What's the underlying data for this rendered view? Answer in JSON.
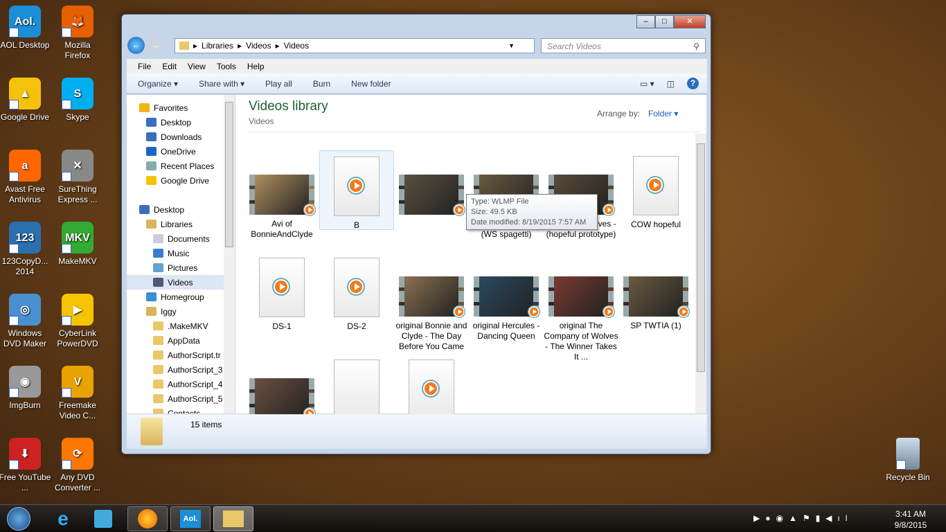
{
  "desktop_icons": [
    {
      "label": "AOL Desktop",
      "color": "#1a8fd8",
      "glyph": "Aol."
    },
    {
      "label": "Mozilla Firefox",
      "color": "#e66000",
      "glyph": "🦊"
    },
    {
      "label": "Google Drive",
      "color": "#f4c20d",
      "glyph": "▲"
    },
    {
      "label": "Skype",
      "color": "#00aff0",
      "glyph": "S"
    },
    {
      "label": "Avast Free Antivirus",
      "color": "#f60",
      "glyph": "a"
    },
    {
      "label": "SureThing Express ...",
      "color": "#888",
      "glyph": "✕"
    },
    {
      "label": "123CopyD... 2014",
      "color": "#2a6fb0",
      "glyph": "123"
    },
    {
      "label": "MakeMKV",
      "color": "#3a3",
      "glyph": "MKV"
    },
    {
      "label": "Windows DVD Maker",
      "color": "#4a8fd0",
      "glyph": "◎"
    },
    {
      "label": "CyberLink PowerDVD",
      "color": "#f5c400",
      "glyph": "▶"
    },
    {
      "label": "ImgBurn",
      "color": "#999",
      "glyph": "◉"
    },
    {
      "label": "Freemake Video C...",
      "color": "#e8a300",
      "glyph": "V"
    },
    {
      "label": "Free YouTube ...",
      "color": "#c22",
      "glyph": "⬇"
    },
    {
      "label": "Any DVD Converter ...",
      "color": "#f70",
      "glyph": "⟳"
    }
  ],
  "recycle_bin": "Recycle Bin",
  "window": {
    "address": [
      "Libraries",
      "Videos",
      "Videos"
    ],
    "search_placeholder": "Search Videos",
    "menu": [
      "File",
      "Edit",
      "View",
      "Tools",
      "Help"
    ],
    "commands": [
      "Organize ▾",
      "Share with ▾",
      "Play all",
      "Burn",
      "New folder"
    ],
    "nav": [
      {
        "label": "Favorites",
        "color": "#f2b41c",
        "indent": 0
      },
      {
        "label": "Desktop",
        "color": "#3a6fc0",
        "indent": 1
      },
      {
        "label": "Downloads",
        "color": "#3a6fc0",
        "indent": 1
      },
      {
        "label": "OneDrive",
        "color": "#1d65c4",
        "indent": 1
      },
      {
        "label": "Recent Places",
        "color": "#8aa",
        "indent": 1
      },
      {
        "label": "Google Drive",
        "color": "#f4c20d",
        "indent": 1
      },
      {
        "label": "",
        "color": "",
        "indent": 0
      },
      {
        "label": "Desktop",
        "color": "#3a6fc0",
        "indent": 0
      },
      {
        "label": "Libraries",
        "color": "#d9b55c",
        "indent": 1
      },
      {
        "label": "Documents",
        "color": "#ccd",
        "indent": 2
      },
      {
        "label": "Music",
        "color": "#3a7cd0",
        "indent": 2
      },
      {
        "label": "Pictures",
        "color": "#6a9fd0",
        "indent": 2
      },
      {
        "label": "Videos",
        "color": "#557",
        "indent": 2,
        "selected": true
      },
      {
        "label": "Homegroup",
        "color": "#3a8fd0",
        "indent": 1
      },
      {
        "label": "Iggy",
        "color": "#d9b55c",
        "indent": 1
      },
      {
        "label": ".MakeMKV",
        "color": "#e9c86a",
        "indent": 2
      },
      {
        "label": "AppData",
        "color": "#e9c86a",
        "indent": 2
      },
      {
        "label": "AuthorScript.tr",
        "color": "#e9c86a",
        "indent": 2
      },
      {
        "label": "AuthorScript_3",
        "color": "#e9c86a",
        "indent": 2
      },
      {
        "label": "AuthorScript_4",
        "color": "#e9c86a",
        "indent": 2
      },
      {
        "label": "AuthorScript_5",
        "color": "#e9c86a",
        "indent": 2
      },
      {
        "label": "Contacts",
        "color": "#e9c86a",
        "indent": 2
      }
    ],
    "library_title": "Videos library",
    "library_subtitle": "Videos",
    "arrange_by_label": "Arrange by:",
    "arrange_by_value": "Folder ▾",
    "files": [
      {
        "name": "Avi of BonnieAndClyde",
        "kind": "video",
        "tint": "#b09060"
      },
      {
        "name": "B",
        "kind": "doc",
        "selected": true
      },
      {
        "name": "",
        "kind": "video",
        "tint": "#5a5040"
      },
      {
        "name": "Bonnie & Clyde - (WS spagetti)",
        "kind": "video",
        "tint": "#6a5a40"
      },
      {
        "name": "Company Wolves - (hopeful prototype)",
        "kind": "video",
        "tint": "#5a4a3a"
      },
      {
        "name": "COW hopeful",
        "kind": "doc"
      },
      {
        "name": "DS-1",
        "kind": "doc"
      },
      {
        "name": "DS-2",
        "kind": "doc"
      },
      {
        "name": "original Bonnie and Clyde - The Day Before You Came",
        "kind": "video",
        "tint": "#8a7050"
      },
      {
        "name": "original Hercules - Dancing Queen",
        "kind": "video",
        "tint": "#2a4a60"
      },
      {
        "name": "original The Company of Wolves - The Winner Takes It ...",
        "kind": "video",
        "tint": "#7a3a30"
      },
      {
        "name": "SP TWTIA (1)",
        "kind": "video",
        "tint": "#6a5a40"
      },
      {
        "name": "",
        "kind": "video",
        "tint": "#6a5040"
      },
      {
        "name": "",
        "kind": "blank"
      },
      {
        "name": "",
        "kind": "doc"
      }
    ],
    "tooltip": {
      "type": "Type: WLMP File",
      "size": "Size: 49.5 KB",
      "date": "Date modified: 8/19/2015 7:57 AM"
    },
    "status": "15 items"
  },
  "taskbar": {
    "time": "3:41 AM",
    "date": "9/8/2015"
  }
}
